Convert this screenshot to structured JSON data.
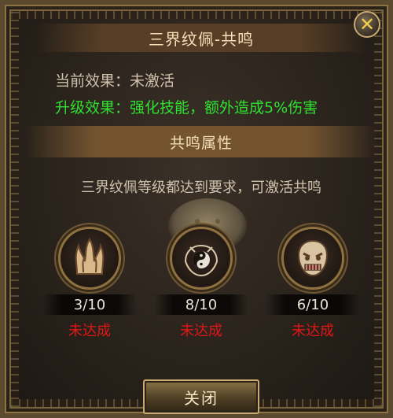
{
  "dialog": {
    "title": "三界纹佩-共鸣",
    "close_icon": "✕",
    "current_effect": "当前效果：未激活",
    "upgrade_effect": "升级效果：强化技能，额外造成5%伤害",
    "section_title": "共鸣属性",
    "description": "三界纹佩等级都达到要求，可激活共鸣",
    "items": [
      {
        "icon": "flame-emblem-icon",
        "level": "3/10",
        "status": "未达成"
      },
      {
        "icon": "yin-yang-emblem-icon",
        "level": "8/10",
        "status": "未达成"
      },
      {
        "icon": "demon-mask-icon",
        "level": "6/10",
        "status": "未达成"
      }
    ],
    "close_button": "关闭"
  },
  "colors": {
    "gold": "#c8aa72",
    "green": "#2fe02f",
    "red": "#e11616",
    "text": "#cfc2ad"
  }
}
